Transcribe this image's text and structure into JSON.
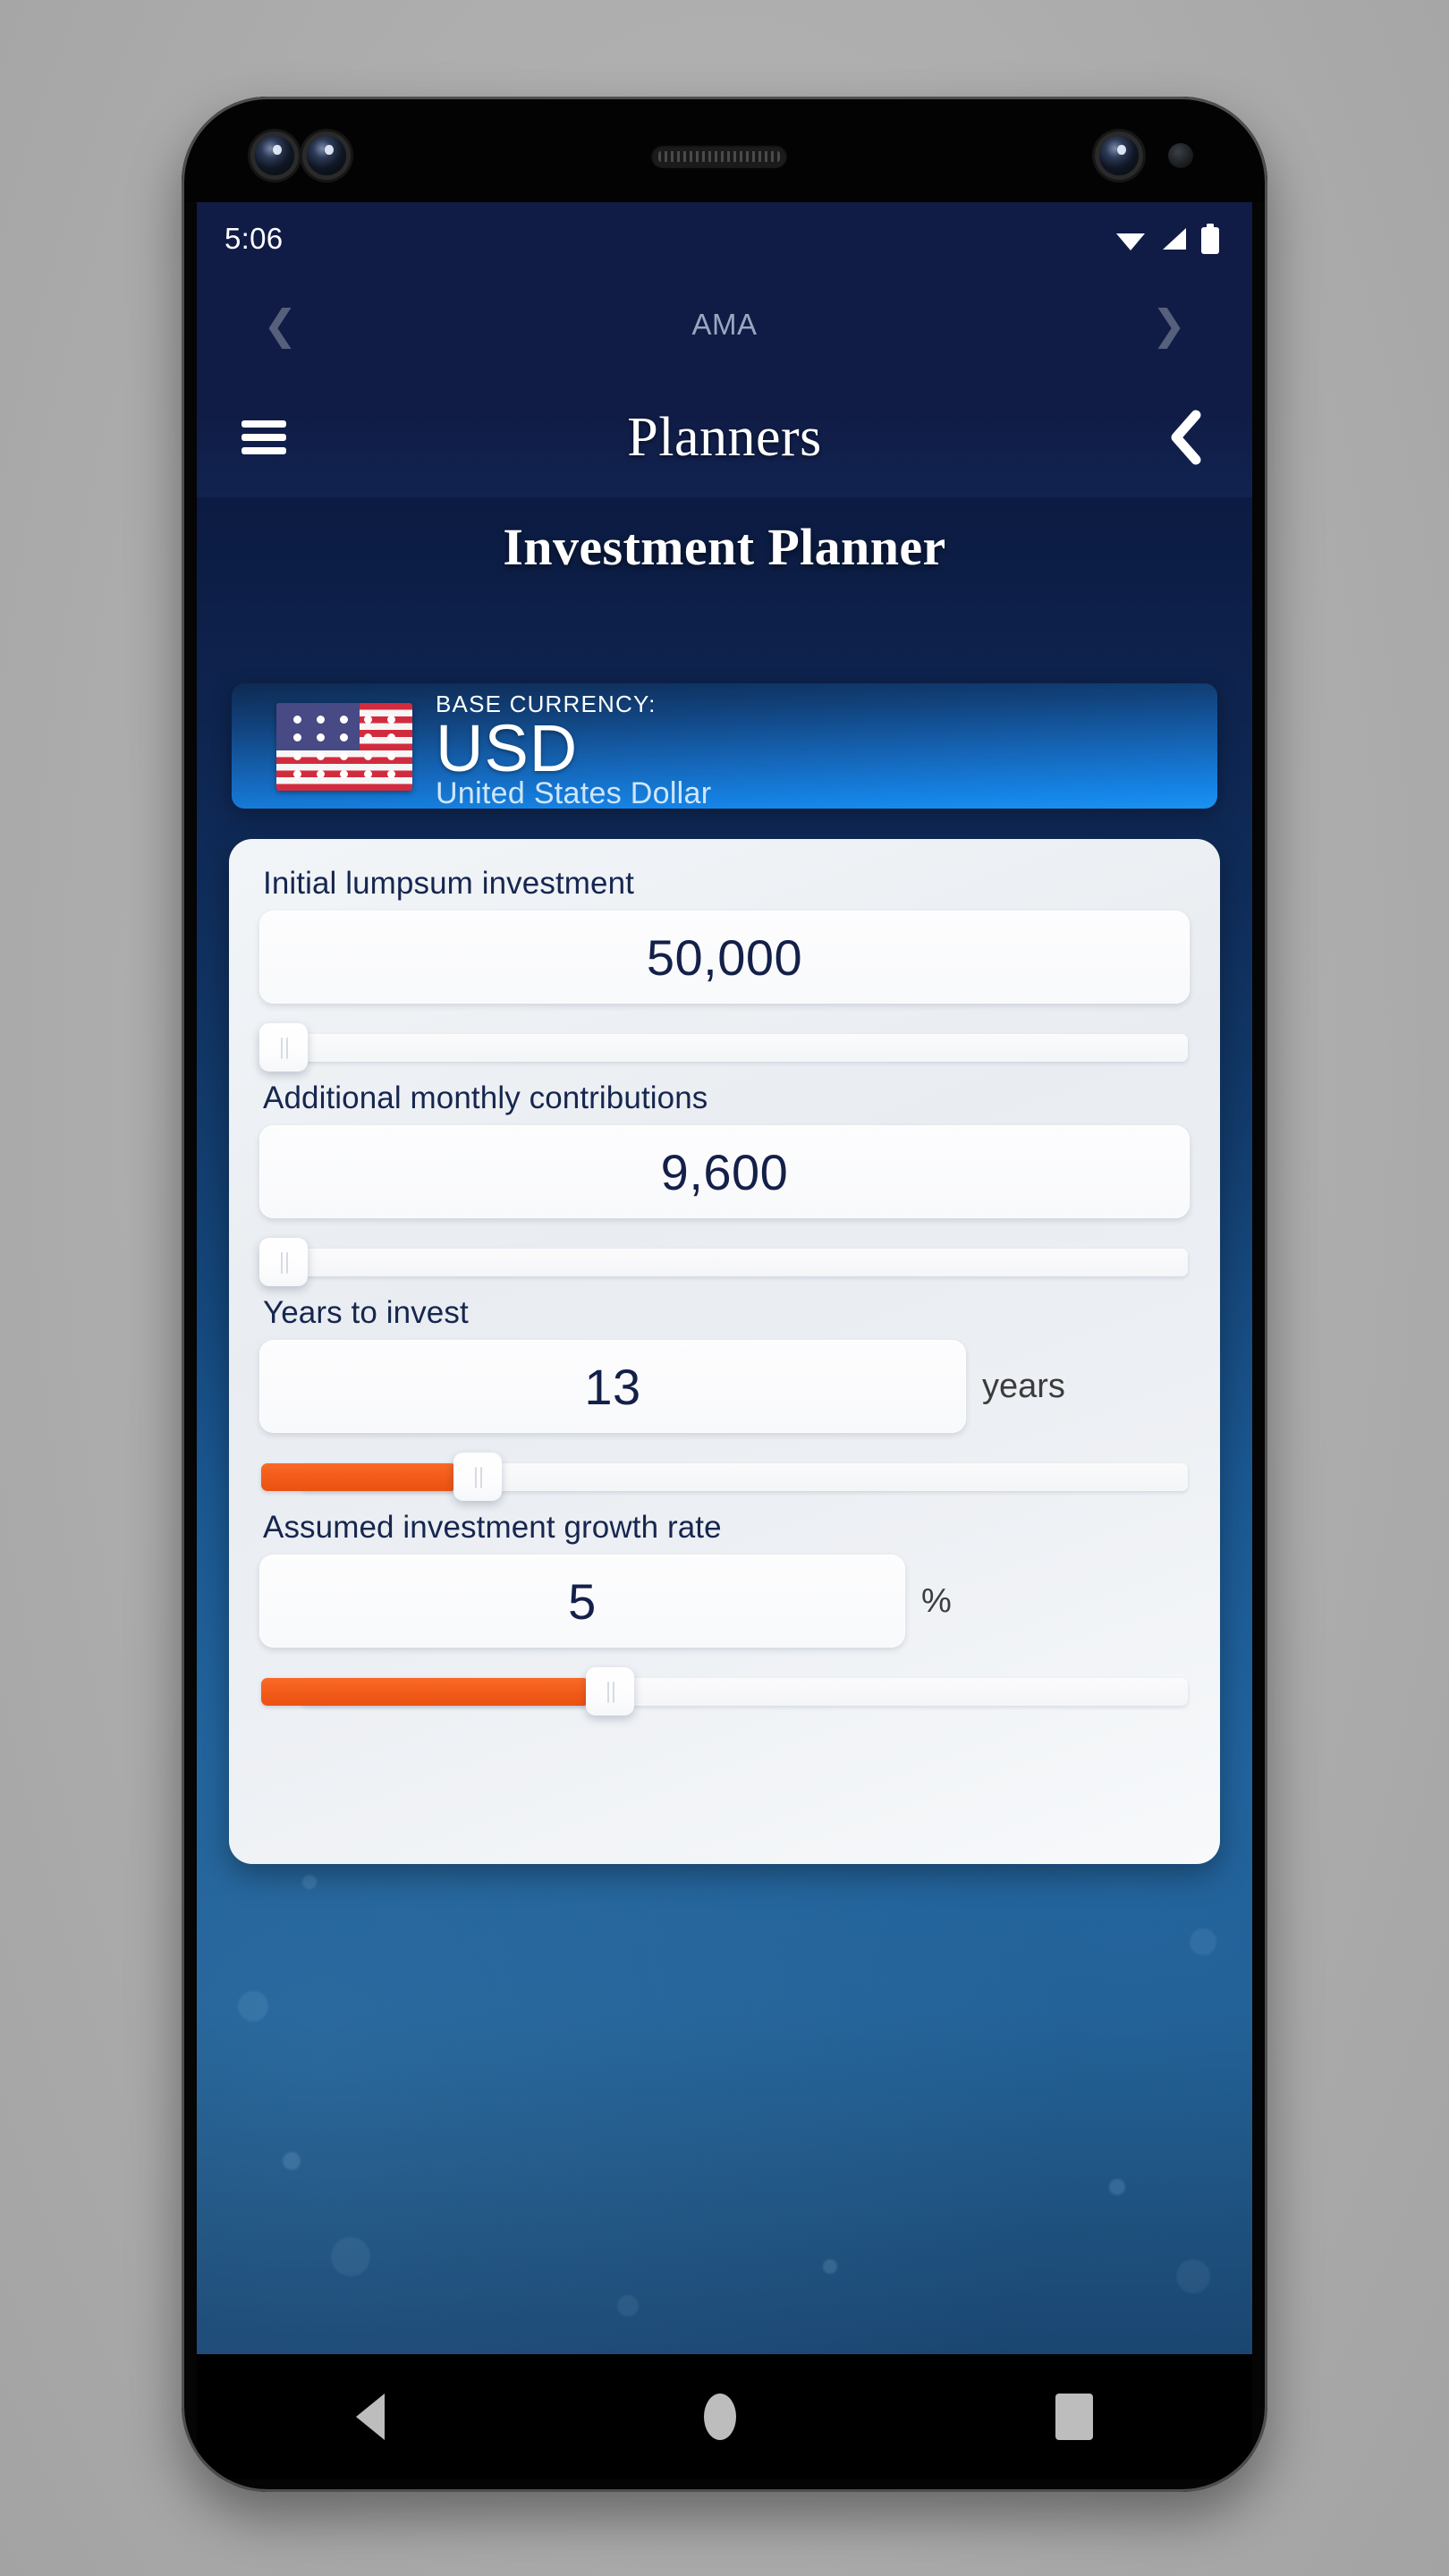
{
  "statusbar": {
    "time": "5:06",
    "icons": [
      "wifi-icon",
      "cellular-signal-icon",
      "battery-icon"
    ]
  },
  "top_nav": {
    "prev_icon": "chevron-left-icon",
    "label": "AMA",
    "next_icon": "chevron-right-icon"
  },
  "appbar": {
    "menu_icon": "hamburger-menu-icon",
    "title": "Planners",
    "back_icon": "chevron-left-icon"
  },
  "page": {
    "title": "Investment Planner"
  },
  "currency_card": {
    "flag_icon": "us-flag-icon",
    "label": "BASE CURRENCY:",
    "code": "USD",
    "name": "United States Dollar"
  },
  "form": {
    "fields": [
      {
        "label": "Initial lumpsum investment",
        "value": "50,000",
        "suffix": "",
        "slider": {
          "fill_percent": 0,
          "thumb_percent": 0
        }
      },
      {
        "label": "Additional monthly contributions",
        "value": "9,600",
        "suffix": "",
        "slider": {
          "fill_percent": 0,
          "thumb_percent": 0
        }
      },
      {
        "label": "Years to invest",
        "value": "13",
        "suffix": "years",
        "slider": {
          "fill_percent": 22,
          "thumb_percent": 22
        }
      },
      {
        "label": "Assumed investment growth rate",
        "value": "5",
        "suffix": "%",
        "slider": {
          "fill_percent": 37,
          "thumb_percent": 37
        }
      }
    ]
  },
  "android_nav": {
    "back_icon": "triangle-back-icon",
    "home_icon": "circle-home-icon",
    "recents_icon": "square-recents-icon"
  },
  "colors": {
    "header_navy": "#101c46",
    "accent_orange": "#f25a19",
    "currency_blue": "#1585e8",
    "text_navy": "#16264f"
  }
}
